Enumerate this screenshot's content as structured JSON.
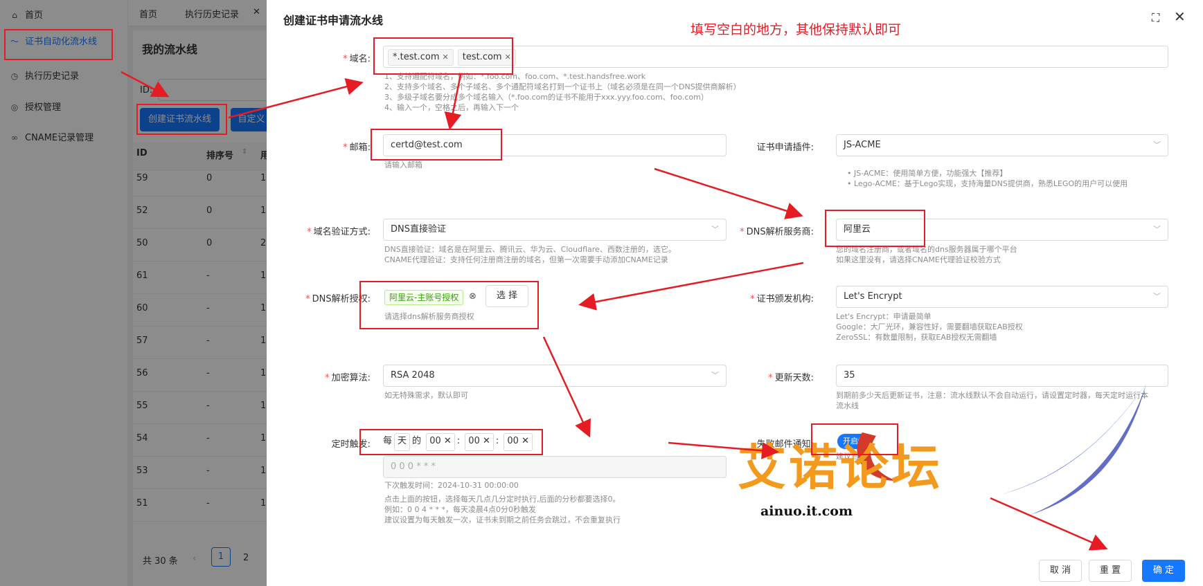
{
  "sidebar": {
    "items": [
      {
        "label": "首页",
        "icon": "home-icon"
      },
      {
        "label": "证书自动化流水线",
        "icon": "pipeline-icon",
        "active": true
      },
      {
        "label": "执行历史记录",
        "icon": "history-icon"
      },
      {
        "label": "授权管理",
        "icon": "auth-icon"
      },
      {
        "label": "CNAME记录管理",
        "icon": "link-icon"
      }
    ]
  },
  "tabs": [
    "首页",
    "执行历史记录"
  ],
  "list": {
    "title": "我的流水线",
    "id_label": "ID:",
    "create_button": "创建证书流水线",
    "custom_button": "自定义",
    "columns": [
      "ID",
      "排序号",
      "用"
    ],
    "rows": [
      {
        "id": "59",
        "order": "0",
        "c": "1"
      },
      {
        "id": "52",
        "order": "0",
        "c": "1"
      },
      {
        "id": "50",
        "order": "0",
        "c": "2"
      },
      {
        "id": "61",
        "order": "-",
        "c": "1"
      },
      {
        "id": "60",
        "order": "-",
        "c": "1"
      },
      {
        "id": "57",
        "order": "-",
        "c": "1"
      },
      {
        "id": "56",
        "order": "-",
        "c": "1"
      },
      {
        "id": "55",
        "order": "-",
        "c": "1"
      },
      {
        "id": "54",
        "order": "-",
        "c": "1"
      },
      {
        "id": "53",
        "order": "-",
        "c": "1"
      },
      {
        "id": "51",
        "order": "-",
        "c": "1"
      }
    ],
    "total": "共 30 条",
    "pages": [
      "1",
      "2"
    ]
  },
  "drawer": {
    "title": "创建证书申请流水线",
    "annotation": "填写空白的地方，其他保持默认即可",
    "domain": {
      "label": "域名",
      "tags": [
        "*.test.com",
        "test.com"
      ],
      "help": [
        "1、支持通配符域名，例如：*.foo.com、foo.com、*.test.handsfree.work",
        "2、支持多个域名、多个子域名、多个通配符域名打到一个证书上（域名必须是在同一个DNS提供商解析）",
        "3、多级子域名要分成多个域名输入（*.foo.com的证书不能用于xxx.yyy.foo.com、foo.com）",
        "4、输入一个，空格之后，再输入下一个"
      ]
    },
    "email": {
      "label": "邮箱",
      "value": "certd@test.com",
      "help": "请输入邮箱"
    },
    "plugin": {
      "label": "证书申请插件",
      "value": "JS-ACME",
      "help": [
        "JS-ACME：使用简单方便，功能强大【推荐】",
        "Lego-ACME：基于Lego实现，支持海量DNS提供商，熟悉LEGO的用户可以使用"
      ]
    },
    "verify": {
      "label": "域名验证方式",
      "value": "DNS直接验证",
      "help": [
        "DNS直接验证：域名是在阿里云、腾讯云、华为云、Cloudflare、西数注册的，选它。",
        "CNAME代理验证：支持任何注册商注册的域名，但第一次需要手动添加CNAME记录"
      ]
    },
    "dns_provider": {
      "label": "DNS解析服务商",
      "value": "阿里云",
      "help": [
        "您的域名注册商，或者域名的dns服务器属于哪个平台",
        "如果这里没有，请选择CNAME代理验证校验方式"
      ]
    },
    "dns_auth": {
      "label": "DNS解析授权",
      "tag": "阿里云-主账号授权",
      "button": "选 择",
      "help": "请选择dns解析服务商授权"
    },
    "ca": {
      "label": "证书颁发机构",
      "value": "Let's Encrypt",
      "help": [
        "Let's Encrypt：申请最简单",
        "Google：大厂光环，兼容性好，需要翻墙获取EAB授权",
        "ZeroSSL：有数量限制，获取EAB授权无需翻墙"
      ]
    },
    "algo": {
      "label": "加密算法",
      "value": "RSA 2048",
      "help": "如无特殊需求，默认即可"
    },
    "renew": {
      "label": "更新天数",
      "value": "35",
      "help": [
        "到期前多少天后更新证书，注意：流水线默认不会自动运行，请设置定时器，每天定时运行本",
        "流水线"
      ]
    },
    "schedule": {
      "label": "定时触发",
      "every": "每",
      "unit": "天",
      "of": "的",
      "h": "00",
      "m": "00",
      "s": "00",
      "sep": ":",
      "cron": "0 0 0 * * *",
      "next": "下次触发时间：2024-10-31 00:00:00",
      "help": [
        "点击上面的按钮，选择每天几点几分定时执行,后面的分秒都要选择0。",
        "例如：0 0 4 * * *，每天凌晨4点0分0秒触发",
        "建议设置为每天触发一次，证书未到期之前任务会跳过，不会重复执行"
      ]
    },
    "fail_mail": {
      "label": "失败邮件通知",
      "toggle": "开启",
      "help": "建议启用"
    },
    "buttons": {
      "cancel": "取 消",
      "reset": "重 置",
      "ok": "确 定"
    },
    "watermark": {
      "text": "艾诺论坛",
      "url": "ainuo.it.com"
    }
  },
  "colors": {
    "primary": "#1677ff",
    "annotation": "#e51c23"
  }
}
